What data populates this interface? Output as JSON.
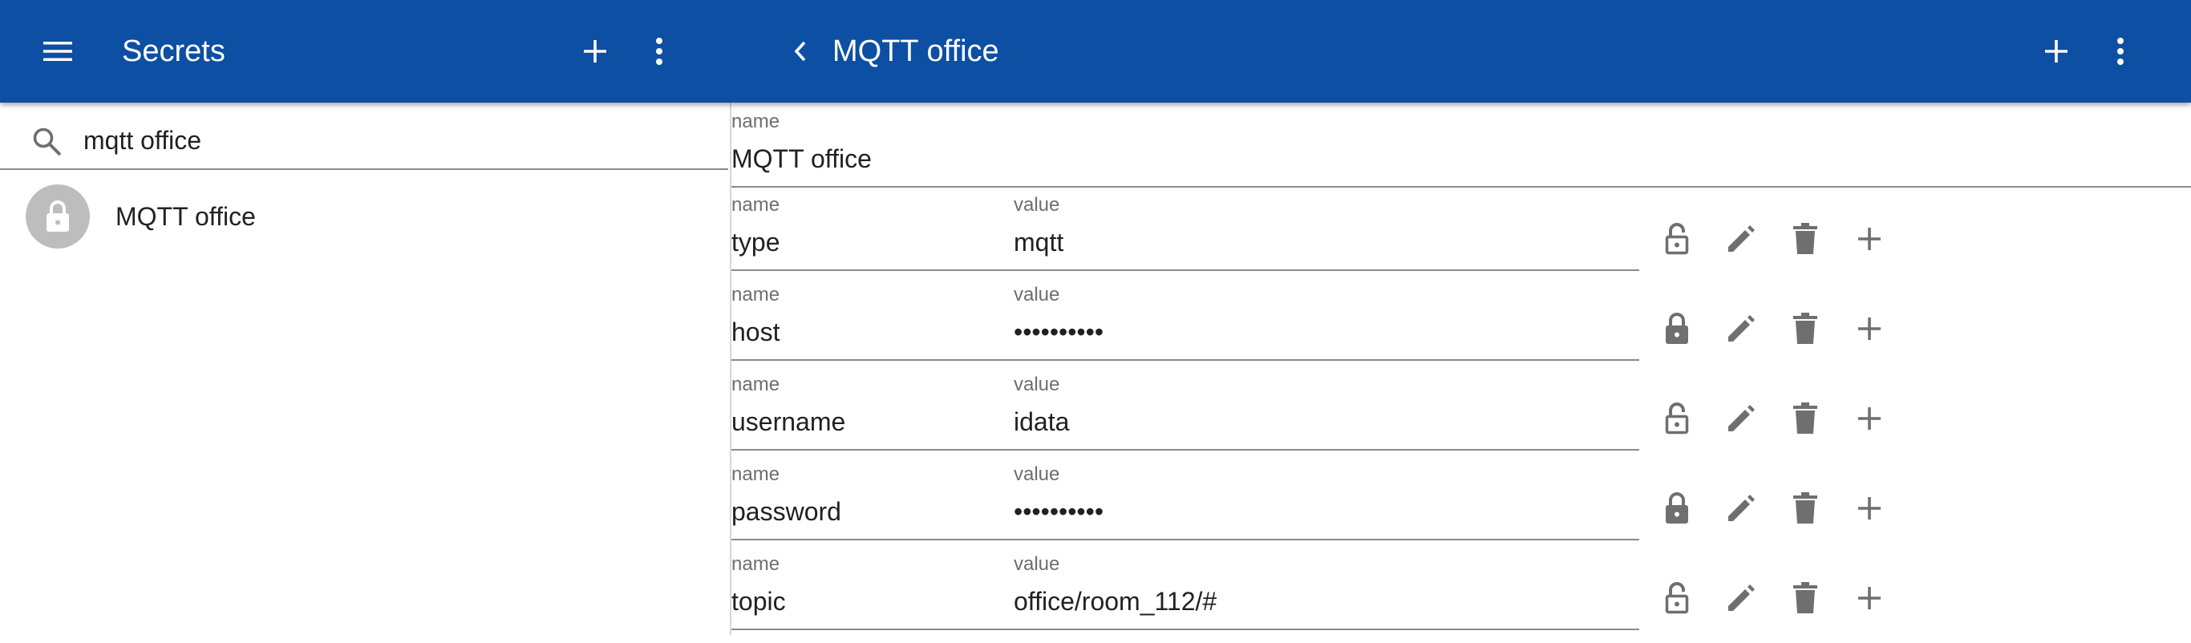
{
  "left_appbar": {
    "menu_icon": "menu-icon",
    "title": "Secrets",
    "add_icon": "plus-icon",
    "more_icon": "more-vertical-icon"
  },
  "right_appbar": {
    "back_icon": "chevron-left-icon",
    "title": "MQTT office",
    "add_icon": "plus-icon",
    "more_icon": "more-vertical-icon"
  },
  "search": {
    "icon": "search-icon",
    "value": "mqtt office",
    "placeholder": ""
  },
  "secret_list": [
    {
      "label": "MQTT office",
      "icon": "lock-icon"
    }
  ],
  "detail": {
    "name_label": "name",
    "name_value": "MQTT office",
    "fields": [
      {
        "name_label": "name",
        "name": "type",
        "value_label": "value",
        "value": "mqtt",
        "locked": false
      },
      {
        "name_label": "name",
        "name": "host",
        "value_label": "value",
        "value": "••••••••••",
        "locked": true
      },
      {
        "name_label": "name",
        "name": "username",
        "value_label": "value",
        "value": "idata",
        "locked": false
      },
      {
        "name_label": "name",
        "name": "password",
        "value_label": "value",
        "value": "••••••••••",
        "locked": true
      },
      {
        "name_label": "name",
        "name": "topic",
        "value_label": "value",
        "value": "office/room_112/#",
        "locked": false
      }
    ],
    "row_action_icons": [
      "lock-icon",
      "pencil-icon",
      "trash-icon",
      "plus-icon"
    ]
  },
  "colors": {
    "appbar": "#0d4fa3",
    "icon_gray": "#6f6f6f",
    "avatar": "#bdbdbd",
    "underline": "#8a8a8a"
  }
}
